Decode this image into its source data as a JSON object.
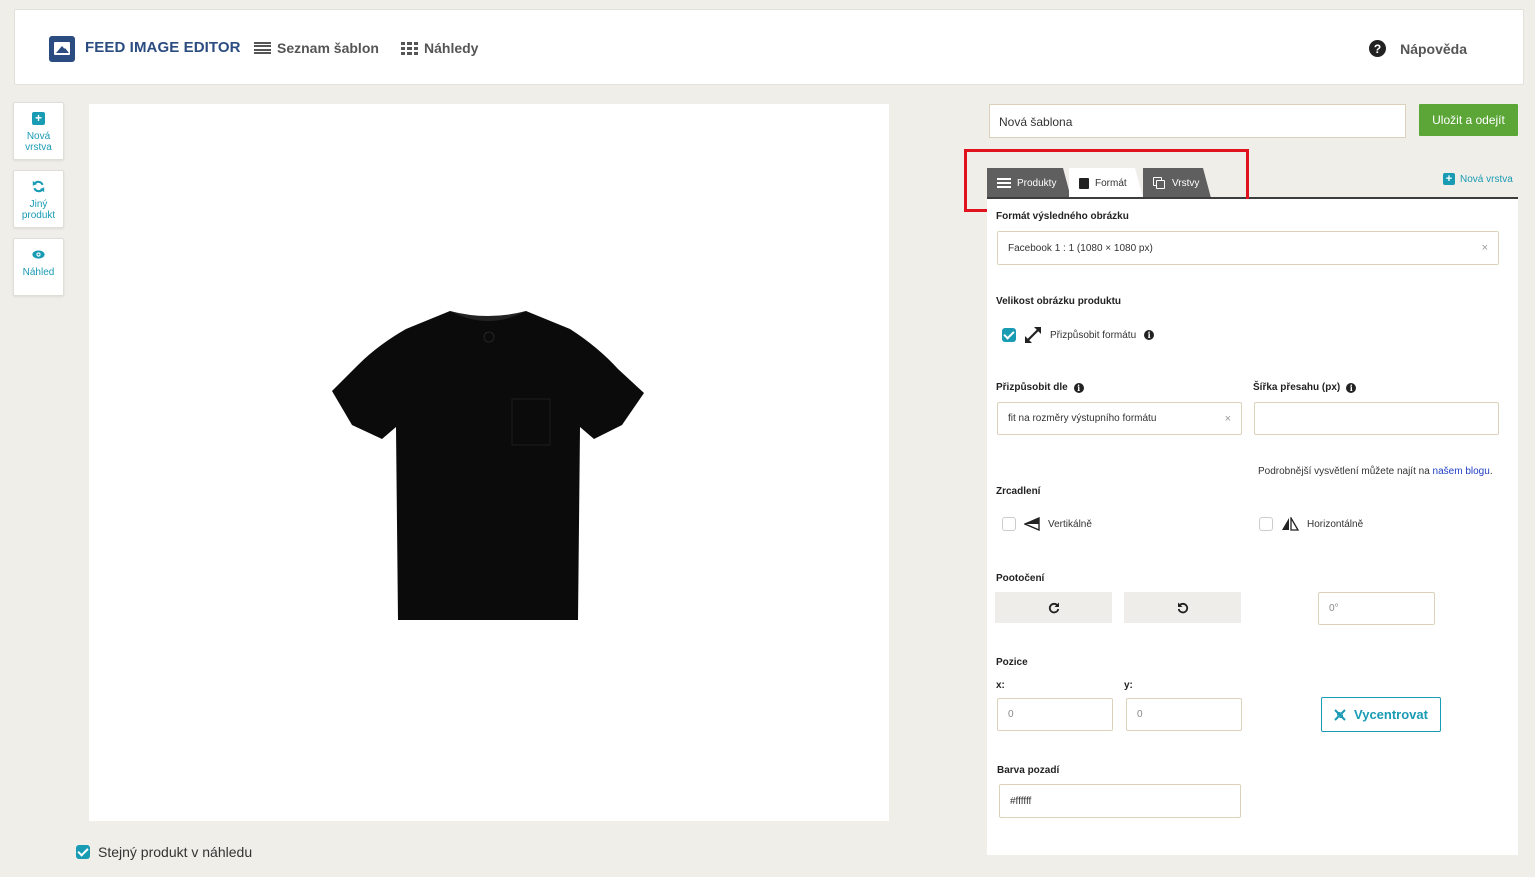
{
  "header": {
    "app_title": "FEED IMAGE EDITOR",
    "nav_templates": "Seznam šablon",
    "nav_previews": "Náhledy",
    "help": "Nápověda"
  },
  "sidebar": {
    "new_layer_line1": "Nová",
    "new_layer_line2": "vrstva",
    "other_product_line1": "Jiný",
    "other_product_line2": "produkt",
    "preview": "Náhled"
  },
  "canvas": {
    "same_product_label": "Stejný produkt v náhledu",
    "same_product_checked": true
  },
  "editor": {
    "template_name": "Nová šablona",
    "save_label": "Uložit a odejít",
    "tabs": [
      "Produkty",
      "Formát",
      "Vrstvy"
    ],
    "active_tab": "Formát",
    "new_layer_link": "Nová vrstva",
    "format_label": "Formát výsledného obrázku",
    "format_value": "Facebook 1 : 1 (1080 × 1080 px)",
    "size_label": "Velikost obrázku produktu",
    "fit_format_label": "Přizpůsobit formátu",
    "fit_format_checked": true,
    "fit_by_label": "Přizpůsobit dle",
    "fit_by_value": "fit na rozměry výstupního formátu",
    "overlap_label": "Šířka přesahu (px)",
    "overlap_value": "",
    "note_text": "Podrobnější vysvětlení můžete najít na ",
    "note_link": "našem blogu",
    "note_end": ".",
    "mirror_label": "Zrcadlení",
    "mirror_vertical": "Vertikálně",
    "mirror_horizontal": "Horizontálně",
    "rotation_label": "Pootočení",
    "rotation_value": "0°",
    "position_label": "Pozice",
    "x_label": "x:",
    "y_label": "y:",
    "x_value": "0",
    "y_value": "0",
    "center_label": "Vycentrovat",
    "bg_label": "Barva pozadí",
    "bg_value": "#ffffff"
  },
  "colors": {
    "accent": "#1a9bb4",
    "save_green": "#5ca637",
    "brand_blue": "#2a4c80",
    "highlight_red": "#e0121d"
  }
}
